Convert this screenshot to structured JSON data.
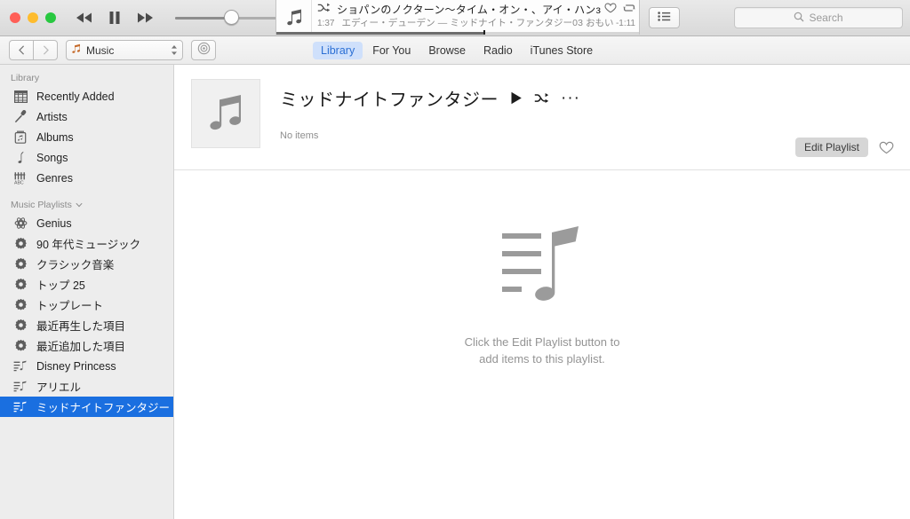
{
  "window": {
    "traffic_lights": [
      "close",
      "minimize",
      "zoom"
    ],
    "colors": {
      "close": "#ff5f57",
      "minimize": "#febc2e",
      "zoom": "#28c840",
      "selection_blue": "#1a6fe0",
      "tab_active_bg": "#cfe0fb",
      "tab_active_text": "#2b6fd4",
      "sidebar_bg": "#ededed"
    }
  },
  "transport": {
    "previous_label": "Previous",
    "playpause_label": "Pause",
    "next_label": "Next",
    "volume_percent": 52
  },
  "now_playing": {
    "artwork_icon": "music-note-icon",
    "shuffle_icon": "shuffle-icon",
    "title": "ショパンのノクターン〜タイム・オン・、アイ・ハンз",
    "subtitle": "エディー・デューデン — ミッドナイト・ファンタジー03 おもい",
    "elapsed": "1:37",
    "remaining": "-1:11",
    "progress_percent": 57,
    "love_icon": "heart-outline-icon",
    "repeat_icon": "repeat-icon"
  },
  "toolbar": {
    "back_label": "‹",
    "forward_label": "›",
    "media_picker": {
      "icon": "music-note-icon",
      "value": "Music"
    },
    "device_button": "device-icon",
    "up_next_button": "up-next-list-icon",
    "tabs": [
      {
        "label": "Library",
        "active": true
      },
      {
        "label": "For You",
        "active": false
      },
      {
        "label": "Browse",
        "active": false
      },
      {
        "label": "Radio",
        "active": false
      },
      {
        "label": "iTunes Store",
        "active": false
      }
    ]
  },
  "search": {
    "placeholder": "Search",
    "value": "",
    "icon": "search-icon"
  },
  "sidebar": {
    "library_header": "Library",
    "library_items": [
      {
        "label": "Recently Added",
        "icon": "grid-icon"
      },
      {
        "label": "Artists",
        "icon": "microphone-icon"
      },
      {
        "label": "Albums",
        "icon": "album-icon"
      },
      {
        "label": "Songs",
        "icon": "note-icon"
      },
      {
        "label": "Genres",
        "icon": "genres-icon"
      }
    ],
    "playlists_header": "Music Playlists",
    "playlists_chevron": "chevron-down-icon",
    "playlist_items": [
      {
        "label": "Genius",
        "icon": "genius-atom-icon",
        "selected": false
      },
      {
        "label": "90 年代ミュージック",
        "icon": "gear-icon",
        "selected": false
      },
      {
        "label": "クラシック音楽",
        "icon": "gear-icon",
        "selected": false
      },
      {
        "label": "トップ 25",
        "icon": "gear-icon",
        "selected": false
      },
      {
        "label": "トップレート",
        "icon": "gear-icon",
        "selected": false
      },
      {
        "label": "最近再生した項目",
        "icon": "gear-icon",
        "selected": false
      },
      {
        "label": "最近追加した項目",
        "icon": "gear-icon",
        "selected": false
      },
      {
        "label": "Disney Princess",
        "icon": "playlist-icon",
        "selected": false
      },
      {
        "label": "アリエル",
        "icon": "playlist-icon",
        "selected": false
      },
      {
        "label": "ミッドナイトファンタジー",
        "icon": "playlist-icon",
        "selected": true
      }
    ]
  },
  "playlist": {
    "artwork_icon": "music-note-icon",
    "title": "ミッドナイトファンタジー",
    "play_icon": "play-icon",
    "shuffle_icon": "shuffle-icon",
    "more_icon": "ellipsis-icon",
    "item_count": "No items",
    "edit_button": "Edit Playlist",
    "love_icon": "heart-outline-icon",
    "empty_icon": "playlist-note-icon",
    "empty_line1": "Click the Edit Playlist button to",
    "empty_line2": "add items to this playlist."
  }
}
